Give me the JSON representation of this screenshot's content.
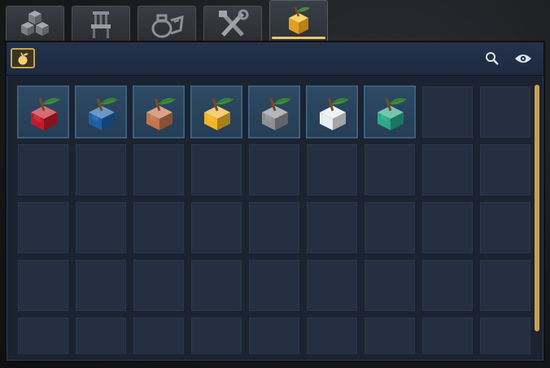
{
  "tabs": [
    {
      "id": "building-blocks",
      "icon": "stacked-cubes-icon",
      "active": false
    },
    {
      "id": "furniture",
      "icon": "chair-icon",
      "active": false
    },
    {
      "id": "brewing",
      "icon": "cauldron-potion-icon",
      "active": false
    },
    {
      "id": "tools",
      "icon": "crossed-tools-icon",
      "active": false
    },
    {
      "id": "special-food",
      "icon": "golden-apple-cube-icon",
      "active": true
    }
  ],
  "toolbar": {
    "filter_icon": "apple-filter-icon",
    "search_icon": "search-icon",
    "view_icon": "eye-icon"
  },
  "grid": {
    "columns": 9,
    "visible_rows": 5,
    "items": [
      {
        "name": "red-apple-cube",
        "color": "#c41b2a"
      },
      {
        "name": "blue-apple-cube",
        "color": "#1c5fa8"
      },
      {
        "name": "copper-apple-cube",
        "color": "#c2734c"
      },
      {
        "name": "gold-apple-cube",
        "color": "#f1b42a"
      },
      {
        "name": "iron-apple-cube",
        "color": "#8d8f93"
      },
      {
        "name": "quartz-apple-cube",
        "color": "#e9edf0"
      },
      {
        "name": "emerald-apple-cube",
        "color": "#2aa887"
      }
    ]
  },
  "colors": {
    "accent": "#f1c46a",
    "panel": "#1b2331",
    "toolbar": "#24324b"
  }
}
